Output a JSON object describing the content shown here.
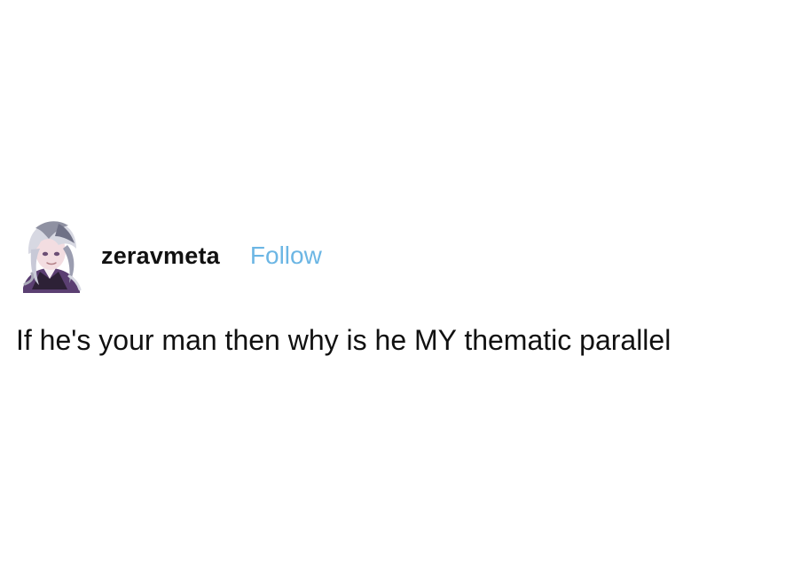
{
  "post": {
    "username": "zeravmeta",
    "follow_label": "Follow",
    "body_text": "If he's your man then why is he MY thematic parallel"
  },
  "colors": {
    "follow_link": "#6cb6e4",
    "text": "#111111",
    "background": "#ffffff"
  },
  "icons": {
    "avatar": "anime-character-avatar"
  }
}
